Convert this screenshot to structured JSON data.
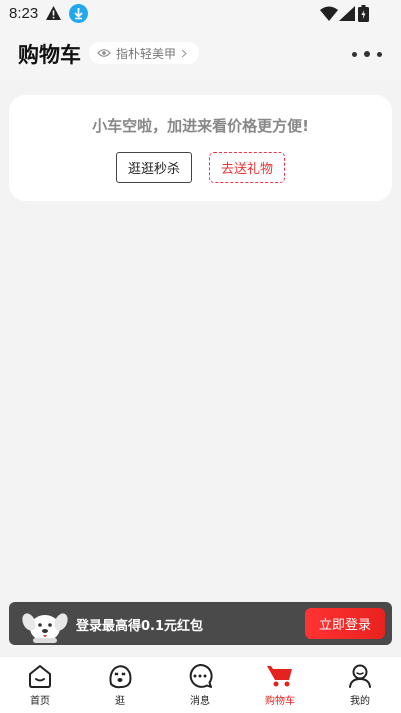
{
  "status_bar": {
    "time": "8:23"
  },
  "header": {
    "title": "购物车",
    "address": "指朴轻美甲"
  },
  "empty": {
    "message": "小车空啦，加进来看价格更方便!",
    "btn_seckill": "逛逛秒杀",
    "btn_gift": "去送礼物"
  },
  "banner": {
    "text": "登录最高得0.1元红包",
    "button": "立即登录"
  },
  "tabs": [
    {
      "label": "首页",
      "icon": "home-icon"
    },
    {
      "label": "逛",
      "icon": "explore-icon"
    },
    {
      "label": "消息",
      "icon": "message-icon"
    },
    {
      "label": "购物车",
      "icon": "cart-icon"
    },
    {
      "label": "我的",
      "icon": "profile-icon"
    }
  ],
  "colors": {
    "accent": "#e4231f",
    "background": "#f3f3f3",
    "banner": "#4a4a4a",
    "download_badge": "#20a7ee"
  }
}
